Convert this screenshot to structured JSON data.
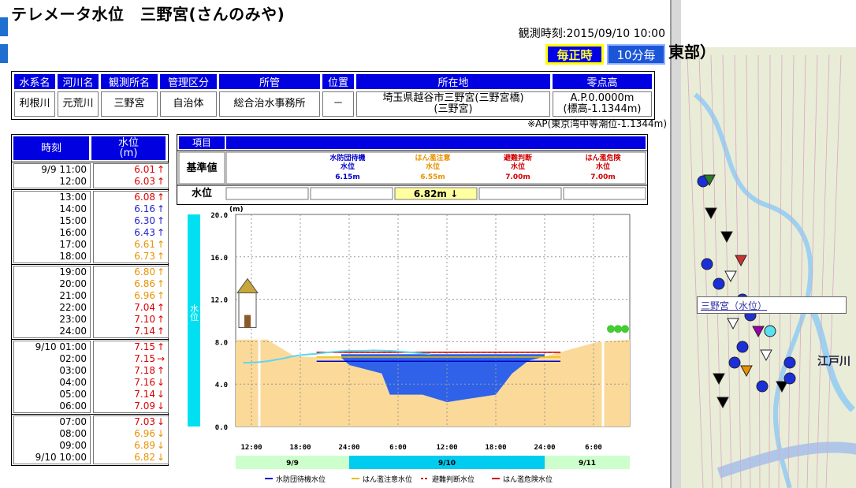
{
  "title": "テレメータ水位　三野宮(さんのみや)",
  "observation_time": "観測時刻:2015/09/10 10:00",
  "buttons": {
    "hourly": "毎正時",
    "ten_min": "10分毎"
  },
  "info": {
    "headers": [
      "水系名",
      "河川名",
      "観測所名",
      "管理区分",
      "所管",
      "位置",
      "所在地",
      "零点高"
    ],
    "values": [
      "利根川",
      "元荒川",
      "三野宮",
      "自治体",
      "総合治水事務所",
      "－",
      "埼玉県越谷市三野宮(三野宮橋)\n(三野宮)",
      "A.P.0.0000m\n(標高-1.1344m)"
    ]
  },
  "note": "※AP(東京湾中等潮位-1.1344m)",
  "timeseries": {
    "headers": [
      "時刻",
      "水位\n(m)"
    ],
    "groups": [
      [
        [
          "9/9 11:00",
          "6.01",
          "↑",
          "#d00"
        ],
        [
          "12:00",
          "6.03",
          "↑",
          "#d00"
        ]
      ],
      [
        [
          "13:00",
          "6.08",
          "↑",
          "#d00"
        ],
        [
          "14:00",
          "6.16",
          "↑",
          "#2222cc"
        ],
        [
          "15:00",
          "6.30",
          "↑",
          "#2222cc"
        ],
        [
          "16:00",
          "6.43",
          "↑",
          "#2222cc"
        ],
        [
          "17:00",
          "6.61",
          "↑",
          "#e89200"
        ],
        [
          "18:00",
          "6.73",
          "↑",
          "#e89200"
        ]
      ],
      [
        [
          "19:00",
          "6.80",
          "↑",
          "#e89200"
        ],
        [
          "20:00",
          "6.86",
          "↑",
          "#e89200"
        ],
        [
          "21:00",
          "6.96",
          "↑",
          "#e89200"
        ],
        [
          "22:00",
          "7.04",
          "↑",
          "#d00"
        ],
        [
          "23:00",
          "7.10",
          "↑",
          "#d00"
        ],
        [
          "24:00",
          "7.14",
          "↑",
          "#d00"
        ]
      ],
      [
        [
          "9/10 01:00",
          "7.15",
          "↑",
          "#d00"
        ],
        [
          "02:00",
          "7.15",
          "→",
          "#d00"
        ],
        [
          "03:00",
          "7.18",
          "↑",
          "#d00"
        ],
        [
          "04:00",
          "7.16",
          "↓",
          "#d00"
        ],
        [
          "05:00",
          "7.14",
          "↓",
          "#d00"
        ],
        [
          "06:00",
          "7.09",
          "↓",
          "#d00"
        ]
      ],
      [
        [
          "07:00",
          "7.03",
          "↓",
          "#d00"
        ],
        [
          "08:00",
          "6.96",
          "↓",
          "#e89200"
        ],
        [
          "09:00",
          "6.89",
          "↓",
          "#e89200"
        ],
        [
          "9/10 10:00",
          "6.82",
          "↓",
          "#e89200"
        ]
      ]
    ]
  },
  "reference": {
    "header_label": "項目",
    "row1_label": "基準値",
    "row2_label": "水位",
    "levels": [
      {
        "name": "水防団待機\n水位",
        "value": "6.15m",
        "color": "#0000cc"
      },
      {
        "name": "はん濫注意\n水位",
        "value": "6.55m",
        "color": "#e89200"
      },
      {
        "name": "避難判断\n水位",
        "value": "7.00m",
        "color": "#d00000"
      },
      {
        "name": "はん濫危険\n水位",
        "value": "7.00m",
        "color": "#d00000"
      }
    ],
    "current": "6.82m ↓"
  },
  "chart_data": {
    "type": "area",
    "ylabel": "水位",
    "unit": "(m)",
    "ylim": [
      0,
      20
    ],
    "yticks": [
      "0.0",
      "4.0",
      "8.0",
      "12.0",
      "16.0",
      "20.0"
    ],
    "xticks": [
      "12:00",
      "18:00",
      "24:00",
      "6:00",
      "12:00",
      "18:00",
      "24:00",
      "6:00"
    ],
    "dates": [
      "9/9",
      "9/10",
      "9/11"
    ],
    "thresholds": [
      {
        "name": "水防団待機水位",
        "value": 6.15,
        "color": "#0000cc",
        "dash": false
      },
      {
        "name": "はん濫注意水位",
        "value": 6.55,
        "color": "#e8c000",
        "dash": false
      },
      {
        "name": "避難判断水位",
        "value": 7.0,
        "color": "#d00000",
        "dash": true
      },
      {
        "name": "はん濫危険水位",
        "value": 7.0,
        "color": "#d00000",
        "dash": false
      }
    ],
    "legend": [
      "水防団待機水位",
      "はん濫注意水位",
      "避難判断水位",
      "はん濫危険水位"
    ],
    "series": [
      {
        "values": [
          [
            11,
            6.01
          ],
          [
            12,
            6.03
          ],
          [
            13,
            6.08
          ],
          [
            14,
            6.16
          ],
          [
            15,
            6.3
          ],
          [
            16,
            6.43
          ],
          [
            17,
            6.61
          ],
          [
            18,
            6.73
          ],
          [
            19,
            6.8
          ],
          [
            20,
            6.86
          ],
          [
            21,
            6.96
          ],
          [
            22,
            7.04
          ],
          [
            23,
            7.1
          ],
          [
            24,
            7.14
          ],
          [
            25,
            7.15
          ],
          [
            26,
            7.15
          ],
          [
            27,
            7.18
          ],
          [
            28,
            7.16
          ],
          [
            29,
            7.14
          ],
          [
            30,
            7.09
          ],
          [
            31,
            7.03
          ],
          [
            32,
            6.96
          ],
          [
            33,
            6.89
          ],
          [
            34,
            6.82
          ]
        ]
      }
    ]
  },
  "map": {
    "station_label": "三野宮（水位）",
    "right_title": "東部）",
    "place_label": "江戸川"
  }
}
